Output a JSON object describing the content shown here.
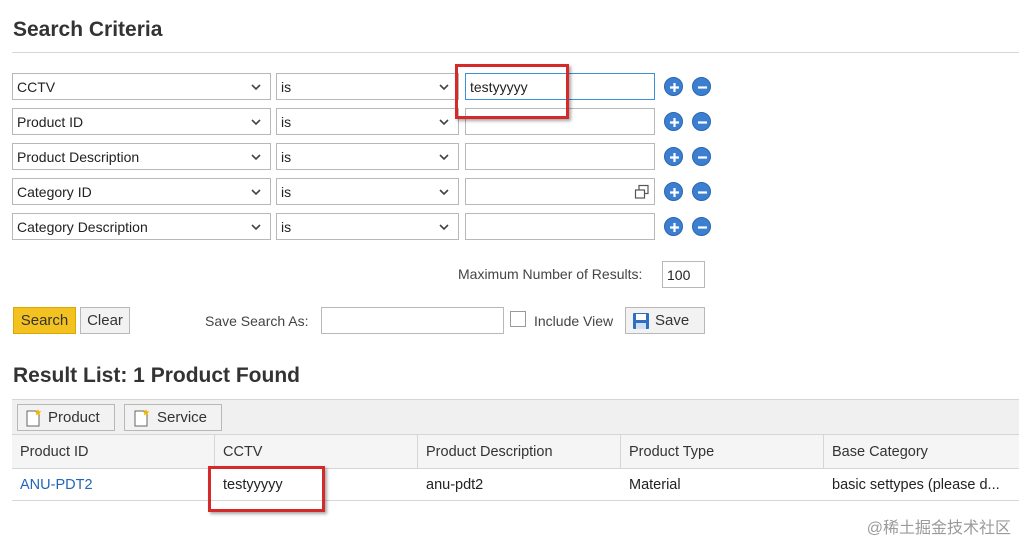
{
  "search_criteria": {
    "title": "Search Criteria",
    "rows": [
      {
        "field": "CCTV",
        "operator": "is",
        "value": "testyyyyy"
      },
      {
        "field": "Product ID",
        "operator": "is",
        "value": ""
      },
      {
        "field": "Product Description",
        "operator": "is",
        "value": ""
      },
      {
        "field": "Category ID",
        "operator": "is",
        "value": ""
      },
      {
        "field": "Category Description",
        "operator": "is",
        "value": ""
      }
    ],
    "max_results_label": "Maximum Number of Results:",
    "max_results_value": "100",
    "search_label": "Search",
    "clear_label": "Clear",
    "save_search_label": "Save Search As:",
    "save_search_value": "",
    "include_view_label": "Include View",
    "save_label": "Save"
  },
  "result_list": {
    "title": "Result List: 1 Product Found",
    "new_product_label": "Product",
    "new_service_label": "Service",
    "columns": [
      "Product ID",
      "CCTV",
      "Product Description",
      "Product Type",
      "Base Category"
    ],
    "rows": [
      {
        "product_id": "ANU-PDT2",
        "cctv": "testyyyyy",
        "description": "anu-pdt2",
        "type": "Material",
        "base_category": "basic settypes (please d..."
      }
    ]
  },
  "watermark": "@稀土掘金技术社区",
  "colors": {
    "accent": "#3c7fd1",
    "primary_button": "#f4c220",
    "highlight": "#d42a2a",
    "link": "#2166b8"
  }
}
